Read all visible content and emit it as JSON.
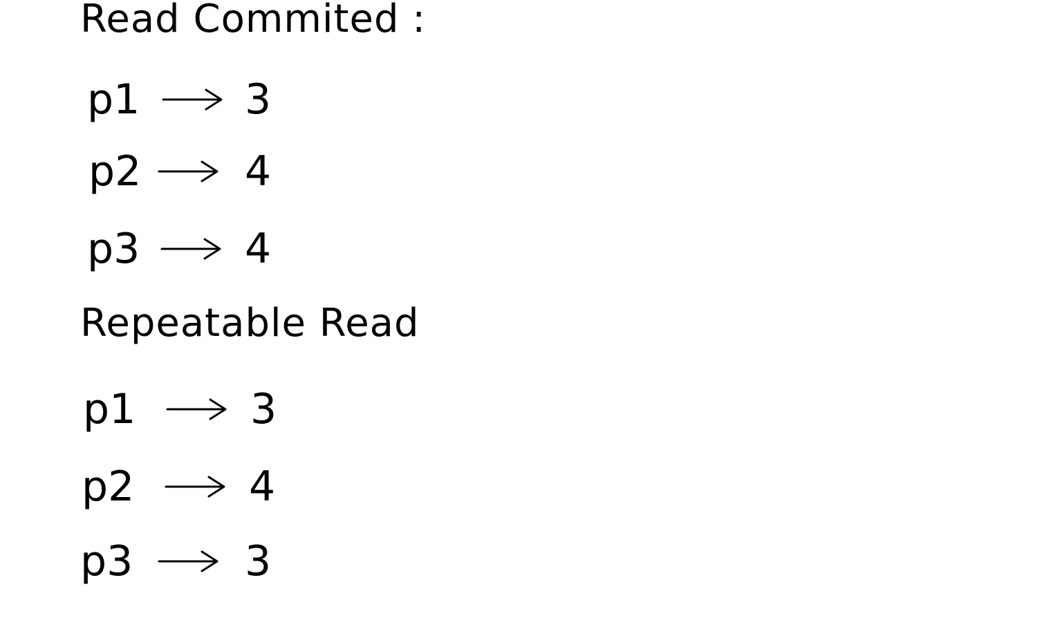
{
  "sections": [
    {
      "heading": "Read Commited :",
      "rows": [
        {
          "process": "p1",
          "arrow": "→",
          "value": "3"
        },
        {
          "process": "p2",
          "arrow": "→",
          "value": "4"
        },
        {
          "process": "p3",
          "arrow": "→",
          "value": "4"
        }
      ]
    },
    {
      "heading": "Repeatable Read",
      "rows": [
        {
          "process": "p1",
          "arrow": "→",
          "value": "3"
        },
        {
          "process": "p2",
          "arrow": "→",
          "value": "4"
        },
        {
          "process": "p3",
          "arrow": "→",
          "value": "3"
        }
      ]
    }
  ],
  "colors": {
    "ink": "#000000",
    "background": "#ffffff"
  }
}
